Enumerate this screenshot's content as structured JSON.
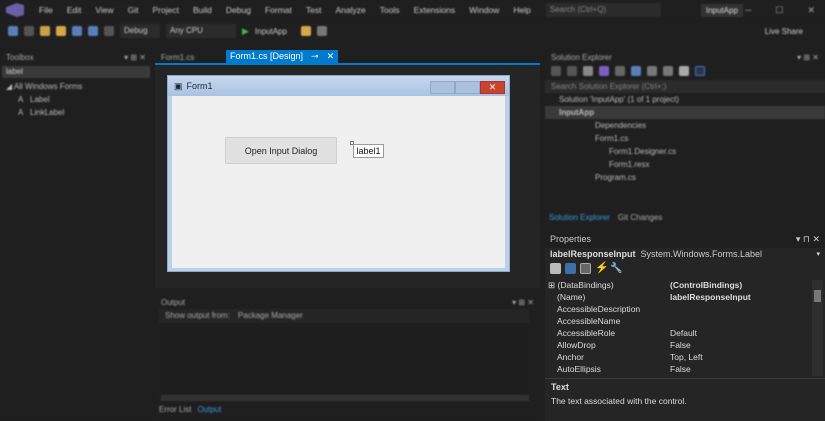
{
  "menu": {
    "items": [
      "File",
      "Edit",
      "View",
      "Git",
      "Project",
      "Build",
      "Debug",
      "Format",
      "Test",
      "Analyze",
      "Tools",
      "Extensions",
      "Window",
      "Help"
    ],
    "search_placeholder": "Search (Ctrl+Q)",
    "app_name": "InputApp"
  },
  "toolbar": {
    "config": "Debug",
    "platform": "Any CPU",
    "run": "InputApp",
    "live_share": "Live Share"
  },
  "toolbox": {
    "title": "Toolbox",
    "search": "label",
    "group": "All Windows Forms",
    "items": [
      "Label",
      "LinkLabel"
    ]
  },
  "doc_tabs": [
    {
      "label": "Form1.cs"
    },
    {
      "label": "Form1.cs [Design]"
    }
  ],
  "form": {
    "title": "Form1",
    "button": "Open Input Dialog",
    "label": "label1"
  },
  "output": {
    "title": "Output",
    "show_from_label": "Show output from:",
    "source": "Package Manager",
    "tabs": [
      "Error List",
      "Output"
    ]
  },
  "solution_explorer": {
    "title": "Solution Explorer",
    "search": "Search Solution Explorer (Ctrl+;)",
    "items": [
      "Solution 'InputApp' (1 of 1 project)",
      "InputApp",
      "Dependencies",
      "Form1.cs",
      "Form1.Designer.cs",
      "Form1.resx",
      "Program.cs"
    ],
    "tabs": [
      "Solution Explorer",
      "Git Changes"
    ]
  },
  "properties": {
    "title": "Properties",
    "object_name": "labelResponseInput",
    "object_type": "System.Windows.Forms.Label",
    "rows": [
      {
        "k": "(DataBindings)",
        "v": "(ControlBindings)"
      },
      {
        "k": "(Name)",
        "v": "labelResponseInput"
      },
      {
        "k": "AccessibleDescription",
        "v": ""
      },
      {
        "k": "AccessibleName",
        "v": ""
      },
      {
        "k": "AccessibleRole",
        "v": "Default"
      },
      {
        "k": "AllowDrop",
        "v": "False"
      },
      {
        "k": "Anchor",
        "v": "Top, Left"
      },
      {
        "k": "AutoEllipsis",
        "v": "False"
      }
    ],
    "desc_title": "Text",
    "desc_text": "The text associated with the control."
  }
}
